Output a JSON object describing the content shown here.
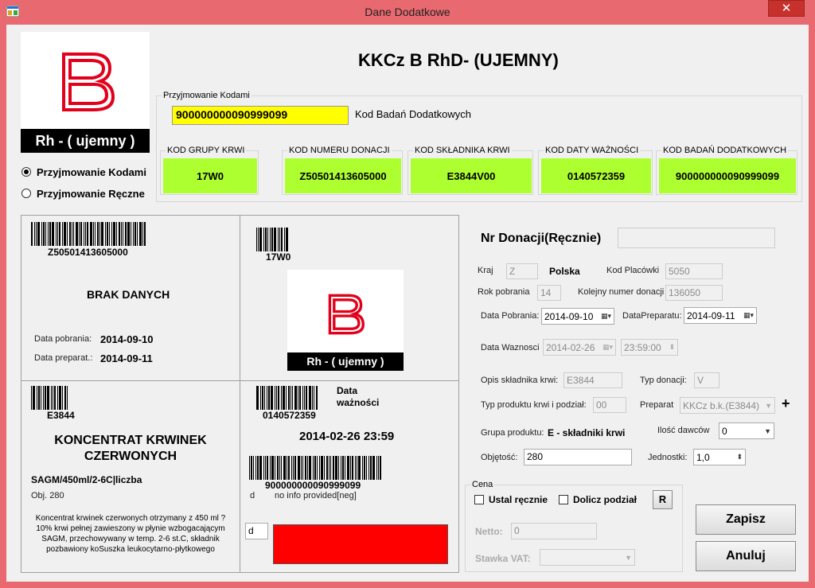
{
  "window": {
    "title": "Dane Dodatkowe",
    "close_glyph": "✕"
  },
  "header": {
    "title": "KKCz B  RhD- (UJEMNY)",
    "logo_letter": "B",
    "rh_label": "Rh - ( ujemny )"
  },
  "modes": {
    "kodami": "Przyjmowanie Kodami",
    "reczne": "Przyjmowanie Ręczne"
  },
  "codes_group": {
    "legend": "Przyjmowanie Kodami",
    "input_value": "900000000090999099",
    "input_label": "Kod Badań Dodatkowych",
    "fields": [
      {
        "label": "KOD GRUPY KRWI",
        "value": "17W0"
      },
      {
        "label": "KOD NUMERU DONACJI",
        "value": "Z50501413605000"
      },
      {
        "label": "KOD SKŁADNIKA KRWI",
        "value": "E3844V00"
      },
      {
        "label": "KOD DATY WAŻNOŚCI",
        "value": "0140572359"
      },
      {
        "label": "KOD BADAŃ DODATKOWYCH",
        "value": "900000000090999099"
      }
    ]
  },
  "label_preview": {
    "donation_code": "Z50501413605000",
    "no_data": "BRAK DANYCH",
    "pobrania_label": "Data pobrania:",
    "pobrania_value": "2014-09-10",
    "preparat_label": "Data preparat.:",
    "preparat_value": "2014-09-11",
    "group_code": "17W0",
    "rh_label": "Rh - ( ujemny )",
    "component_code": "E3844",
    "component_name": "KONCENTRAT KRWINEK CZERWONYCH",
    "component_spec": "SAGM/450ml/2-6C|liczba",
    "volume": "Obj. 280",
    "description": "Koncentrat krwinek czerwonych otrzymany z 450 ml ? 10% krwi pełnej zawieszony w płynie wzbogacającym SAGM, przechowywany w temp. 2-6 st.C, składnik pozbawiony koSuszka leukocytarno-płytkowego",
    "expiry_code": "0140572359",
    "expiry_label": "Data ważności",
    "expiry_value": "2014-02-26 23:59",
    "tests_code": "900000000090999099",
    "d_label": "d",
    "no_info": "no info provided[neg]",
    "d_box": "d",
    "red_color": "#ff0000"
  },
  "manual": {
    "title": "Nr Donacji(Ręcznie)",
    "kraj_label": "Kraj",
    "kraj_value": "Z",
    "country": "Polska",
    "kod_placowki_label": "Kod Placówki",
    "kod_placowki_value": "5050",
    "rok_label": "Rok pobrania",
    "rok_value": "14",
    "kolejny_label": "Kolejny numer donacji",
    "kolejny_value": "136050",
    "data_pobrania_label": "Data Pobrania:",
    "data_pobrania_value": "2014-09-10",
    "data_preparatu_label": "DataPreparatu:",
    "data_preparatu_value": "2014-09-11",
    "data_waznosci_label": "Data Waznosci",
    "data_waznosci_value": "2014-02-26",
    "time_value": "23:59:00",
    "opis_label": "Opis składnika krwi:",
    "opis_value": "E3844",
    "typ_donacji_label": "Typ donacji:",
    "typ_donacji_value": "V",
    "typ_produktu_label": "Typ produktu krwi i podział:",
    "typ_produktu_value": "00",
    "preparat_label": "Preparat",
    "preparat_value": "KKCz b.k.(E3844)",
    "plus": "+",
    "grupa_label": "Grupa produktu:",
    "grupa_value": "E - składniki krwi",
    "ilosc_label": "Ilość dawców",
    "ilosc_value": "0",
    "objetosc_label": "Objętość:",
    "objetosc_value": "280",
    "jednostki_label": "Jednostki:",
    "jednostki_value": "1,0"
  },
  "cena": {
    "legend": "Cena",
    "ustal": "Ustal ręcznie",
    "dolicz": "Dolicz podział",
    "r_button": "R",
    "netto_label": "Netto:",
    "netto_value": "0",
    "vat_label": "Stawka VAT:"
  },
  "actions": {
    "save": "Zapisz",
    "cancel": "Anuluj"
  },
  "colors": {
    "frame": "#e8696f",
    "green": "#adff2f",
    "yellow": "#ffff00",
    "logo_red": "#e2001a"
  }
}
